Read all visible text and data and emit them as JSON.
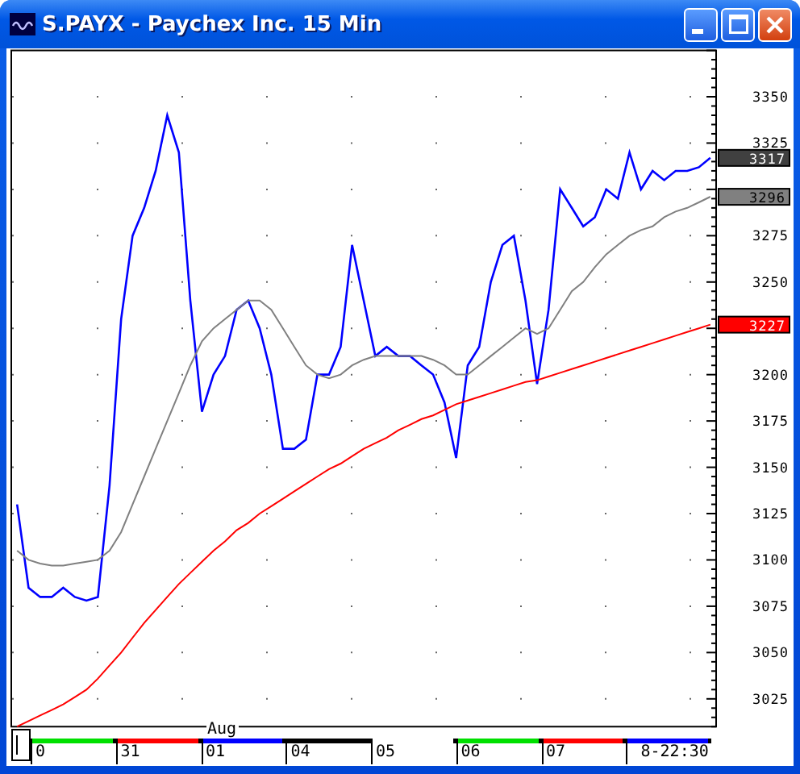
{
  "window": {
    "title": "S.PAYX - Paychex Inc. 15 Min"
  },
  "chart": {
    "last_value_labels": [
      "3317",
      "3296",
      "3227"
    ],
    "chart_data": {
      "type": "line",
      "grid": true,
      "ylim": [
        3010,
        3375
      ],
      "yticks": [
        3025,
        3050,
        3075,
        3100,
        3125,
        3150,
        3175,
        3200,
        3250,
        3275,
        3325,
        3350
      ],
      "series": [
        {
          "color": "#0000ff",
          "values": [
            3130,
            3085,
            3080,
            3080,
            3085,
            3080,
            3078,
            3080,
            3140,
            3230,
            3275,
            3290,
            3310,
            3340,
            3320,
            3240,
            3180,
            3200,
            3210,
            3235,
            3240,
            3225,
            3200,
            3160,
            3160,
            3165,
            3200,
            3200,
            3215,
            3270,
            3240,
            3210,
            3215,
            3210,
            3210,
            3205,
            3200,
            3185,
            3155,
            3205,
            3215,
            3250,
            3270,
            3275,
            3240,
            3195,
            3235,
            3300,
            3290,
            3280,
            3285,
            3300,
            3295,
            3320,
            3300,
            3310,
            3305,
            3310,
            3310,
            3312,
            3317
          ]
        },
        {
          "color": "#808080",
          "values": [
            3105,
            3100,
            3098,
            3097,
            3097,
            3098,
            3099,
            3100,
            3105,
            3115,
            3130,
            3145,
            3160,
            3175,
            3190,
            3205,
            3218,
            3225,
            3230,
            3235,
            3240,
            3240,
            3235,
            3225,
            3215,
            3205,
            3200,
            3198,
            3200,
            3205,
            3208,
            3210,
            3210,
            3210,
            3210,
            3210,
            3208,
            3205,
            3200,
            3200,
            3205,
            3210,
            3215,
            3220,
            3225,
            3222,
            3225,
            3235,
            3245,
            3250,
            3258,
            3265,
            3270,
            3275,
            3278,
            3280,
            3285,
            3288,
            3290,
            3293,
            3296
          ]
        },
        {
          "color": "#ff0000",
          "values": [
            3010,
            3013,
            3016,
            3019,
            3022,
            3026,
            3030,
            3036,
            3043,
            3050,
            3058,
            3066,
            3073,
            3080,
            3087,
            3093,
            3099,
            3105,
            3110,
            3116,
            3120,
            3125,
            3129,
            3133,
            3137,
            3141,
            3145,
            3149,
            3152,
            3156,
            3160,
            3163,
            3166,
            3170,
            3173,
            3176,
            3178,
            3181,
            3184,
            3186,
            3188,
            3190,
            3192,
            3194,
            3196,
            3197,
            3199,
            3201,
            3203,
            3205,
            3207,
            3209,
            3211,
            3213,
            3215,
            3217,
            3219,
            3221,
            3223,
            3225,
            3227
          ]
        }
      ]
    }
  },
  "time_axis": {
    "month": "Aug",
    "segments": [
      {
        "label": "0",
        "color": "#00e000"
      },
      {
        "label": "31",
        "color": "#ff0000"
      },
      {
        "label": "01",
        "color": "#0000ff"
      },
      {
        "label": "04",
        "color": "#000000"
      },
      {
        "label": "05",
        "color": "#ffffff"
      },
      {
        "label": "06",
        "color": "#00e000"
      },
      {
        "label": "07",
        "color": "#ff0000"
      },
      {
        "label": "8-22:30",
        "color": "#0000ff"
      }
    ]
  }
}
